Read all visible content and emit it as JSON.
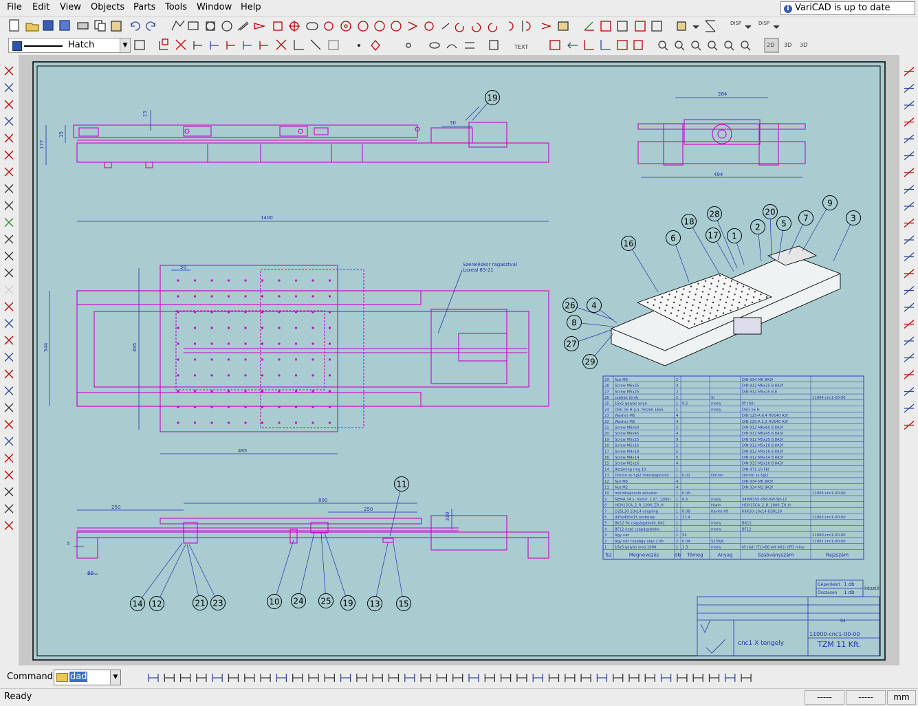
{
  "menu": [
    "File",
    "Edit",
    "View",
    "Objects",
    "Parts",
    "Tools",
    "Window",
    "Help"
  ],
  "update_notice": "VariCAD is up to date",
  "layer": {
    "name": "Hatch"
  },
  "command": {
    "label": "Command:",
    "value": "dad"
  },
  "status": {
    "text": "Ready",
    "field1": "-----",
    "field2": "-----",
    "units": "mm"
  },
  "colors": {
    "drawing_bg": "#a8ccd0",
    "geometry": "#cc00cc",
    "dimension": "#2a2ab0",
    "ui_bg": "#ececec"
  },
  "drawing": {
    "dims": [
      "15",
      "15",
      "177",
      "30",
      "284",
      "494",
      "1400",
      "50",
      "495",
      "344",
      "495",
      "250",
      "800",
      "250",
      "310",
      "5",
      "80"
    ],
    "note": [
      "Szereléskor ragasztval",
      "Loxeal 83-21"
    ],
    "balloons": [
      "19",
      "16",
      "6",
      "18",
      "28",
      "17",
      "1",
      "2",
      "20",
      "5",
      "7",
      "9",
      "3",
      "26",
      "4",
      "8",
      "27",
      "29",
      "11",
      "14",
      "12",
      "21",
      "23",
      "10",
      "24",
      "25",
      "19",
      "13",
      "15"
    ],
    "bom_header": [
      "Tsz",
      "Megnevezés",
      "db",
      "Tömeg",
      "Anyag",
      "Szabványszám",
      "Rajzszám"
    ],
    "bom_rows": [
      [
        "29",
        "Nut M6",
        "2",
        "",
        "",
        "DIN 934 M6 8A3f",
        ""
      ],
      [
        "28",
        "Screw M6x25",
        "4",
        "",
        "",
        "DIN 912 M6x25 8.8A3f",
        ""
      ],
      [
        "27",
        "Screw M5x25",
        "2",
        "",
        "",
        "DIN 912 M5x25 8.8",
        ""
      ],
      [
        "26",
        "csatlak tömb",
        "2",
        "",
        "St",
        "",
        "11004-cnc1-00-00"
      ],
      [
        "25",
        "16x5 golyós anya",
        "1",
        "0.5",
        "many",
        "tft (tol)",
        ""
      ],
      [
        "24",
        "DSG 16 H g.a. fészek 16x5",
        "1",
        "",
        "many",
        "DSG 16 H",
        ""
      ],
      [
        "23",
        "Washer M6",
        "4",
        "",
        "",
        "DIN 125-A 6.4 HV140 A3f",
        ""
      ],
      [
        "22",
        "Washer M2",
        "4",
        "",
        "",
        "DIN 125-A 2.2 HV140 A3f",
        ""
      ],
      [
        "21",
        "Screw M6x60",
        "2",
        "",
        "",
        "DIN 912 M6x60 8.8A3f",
        ""
      ],
      [
        "20",
        "Screw M6x45",
        "4",
        "",
        "",
        "DIN 912 M6x45 8.8A3f",
        ""
      ],
      [
        "19",
        "Screw M5x25",
        "9",
        "",
        "",
        "DIN 912 M5x25 8.8A3f",
        ""
      ],
      [
        "18",
        "Screw M5x16",
        "2",
        "",
        "",
        "DIN 912 M5x16 8.8A3f",
        ""
      ],
      [
        "17",
        "Screw M4x18",
        "5",
        "",
        "",
        "DIN 912 M4x18 8.8A3f",
        ""
      ],
      [
        "16",
        "Screw M4x14",
        "5",
        "",
        "",
        "DIN 912 M4x14 8.8A3f",
        ""
      ],
      [
        "15",
        "Screw M2x16",
        "4",
        "",
        "",
        "DIN 933 M2x16 8.8A3f",
        ""
      ],
      [
        "14",
        "Retaining ring 10",
        "1",
        "",
        "",
        "DIN 471 10 Fbl",
        ""
      ],
      [
        "13",
        "Omron ss-5gl2 mikrokapcsoló",
        "1",
        "0.01",
        "Omron",
        "Omron ss-5gl2",
        ""
      ],
      [
        "12",
        "Nut M6",
        "4",
        "",
        "",
        "DIN 934 M6 8A3f",
        ""
      ],
      [
        "11",
        "Nut M2",
        "4",
        "",
        "",
        "DIN 934 M2 8A3f",
        ""
      ],
      [
        "10",
        "mikrokapcsoló aktuátor",
        "1",
        "0.05",
        "",
        "",
        "11005-cnc1-00-00"
      ],
      [
        "9",
        "NEMA 34 s. motor, 1.8°, 12Nm",
        "1",
        "6.6",
        "many",
        "34HM155-058-8W-SB-12",
        ""
      ],
      [
        "8",
        "HGH15CA_2_R_1000_Z0_H",
        "2",
        "",
        "Hiwin",
        "HGH15CA_2_R_1000_Z0_H",
        ""
      ],
      [
        "7",
        "D25L30 10x14 coupling",
        "1",
        "0.08",
        "Kaviro kft",
        "KKK30-10x14-D30L30",
        ""
      ],
      [
        "6",
        "495x495x15 asztallap",
        "1",
        "27.4",
        "",
        "",
        "11002-cnc1-00-00"
      ],
      [
        "5",
        "BK12 fix csapágyblokk_642",
        "1",
        "",
        "many",
        "BK12",
        ""
      ],
      [
        "4",
        "BF12 úszó csapágyblokk",
        "1",
        "",
        "many",
        "BF12",
        ""
      ],
      [
        "3",
        "Agy váz",
        "1",
        "54",
        "",
        "",
        "11000-cnc1-00-00"
      ],
      [
        "2",
        "Agy váz csapágy alap 2 db",
        "2",
        "0.04",
        "S235JR",
        "",
        "11001-cnc1-00-00"
      ],
      [
        "1",
        "16x5 golyós orsó 1000",
        "1",
        "1.3",
        "many",
        "tft (tol) (T1=B0 wit 401) eFD minp",
        ""
      ]
    ],
    "title_block": {
      "qty1_label": "Gépenként",
      "qty1": "1 db",
      "qty2_label": "Összesen",
      "qty2": "1 db",
      "keszul": "készül",
      "drawing_no": "11000-cnc1-00-00",
      "title": "cnc1 X tengely",
      "company": "TZM 11 Kft.",
      "sheet": "94"
    }
  }
}
